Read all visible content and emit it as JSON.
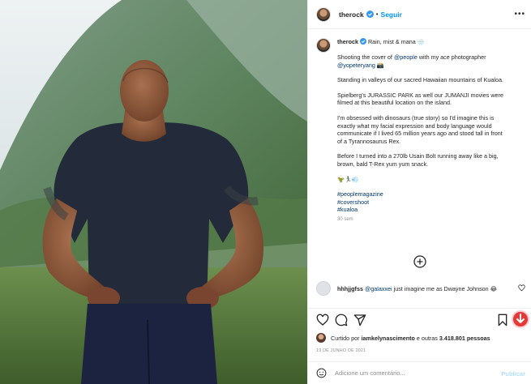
{
  "post": {
    "username": "therock",
    "follow_label": "Seguir",
    "more_icon": "more-options-icon"
  },
  "caption": {
    "title": "Rain, mist & mana 🌧️",
    "p1_a": "Shooting the cover of ",
    "p1_link1": "@people",
    "p1_b": " with my ace photographer",
    "p1_link2": "@yopeteryang",
    "p1_c": " 📸",
    "p2": "Standing in valleys of our sacred Hawaiian mountains of Kualoa.",
    "p3_l1": "Spielberg's JURASSIC PARK as well our JUMANJI movies were",
    "p3_l2": "filmed at this beautiful location on the island.",
    "p4_l1": "I'm obsessed with dinosaurs (true story) so I'd imagine this is",
    "p4_l2": "exactly what my facial expression and body language would",
    "p4_l3": "communicate if I lived 65 million years ago and stood tall in front",
    "p4_l4": "of a Tyrannosaurus Rex.",
    "p5_l1": "Before I turned into a 270lb Usain Bolt running away like a big,",
    "p5_l2": "brown, bald T-Rex yum yum snack.",
    "emojis": "🦖🏃🏾‍♂️💨",
    "hashtags": [
      "#peoplemagazine",
      "#covershoot",
      "#kualoa"
    ],
    "time_ago": "30 sem"
  },
  "comment": {
    "username": "hhhjjgfss",
    "mention": "@galaxxei",
    "text": " just imagine me as Dwayne Johnson 😂"
  },
  "likes": {
    "prefix": "Curtido por ",
    "user": "iamkelynascimento",
    "middle": " e outras ",
    "count": "3.418.801 pessoas"
  },
  "date": "19 DE JUNHO DE 2021",
  "add_comment": {
    "placeholder": "Adicione um comentário...",
    "publish_label": "Publicar"
  },
  "colors": {
    "link": "#0095f6",
    "hashtag": "#00376b",
    "download": "#e53935"
  }
}
